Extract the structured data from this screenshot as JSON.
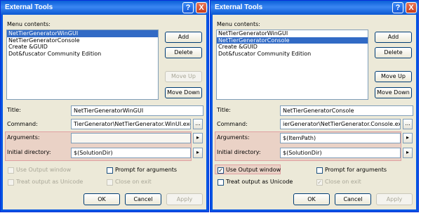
{
  "left": {
    "title": "External Tools",
    "help_glyph": "?",
    "close_glyph": "X",
    "menu_contents_label": "Menu contents:",
    "menu_items": [
      "NetTierGeneratorWinGUI",
      "NetTierGeneratorConsole",
      "Create &GUID",
      "Dot&fuscator Community Edition"
    ],
    "selected_index": 0,
    "add": "Add",
    "delete": "Delete",
    "move_up": "Move Up",
    "move_down": "Move Down",
    "title_label": "Title:",
    "title_value": "NetTierGeneratorWinGUI",
    "command_label": "Command:",
    "command_value": "TierGenerator\\NetTierGenerator.WinUI.exe",
    "browse": "...",
    "arguments_label": "Arguments:",
    "arguments_value": "",
    "initdir_label": "Initial directory:",
    "initdir_value": "$(SolutionDir)",
    "arrow": "▸",
    "use_output": "Use Output window",
    "use_output_checked": false,
    "prompt_args": "Prompt for arguments",
    "prompt_checked": false,
    "unicode": "Treat output as Unicode",
    "close_exit": "Close on exit",
    "ok": "OK",
    "cancel": "Cancel",
    "apply": "Apply"
  },
  "right": {
    "title": "External Tools",
    "help_glyph": "?",
    "close_glyph": "X",
    "menu_contents_label": "Menu contents:",
    "menu_items": [
      "NetTierGeneratorWinGUI",
      "NetTierGeneratorConsole",
      "Create &GUID",
      "Dot&fuscator Community Edition"
    ],
    "selected_index": 1,
    "add": "Add",
    "delete": "Delete",
    "move_up": "Move Up",
    "move_down": "Move Down",
    "title_label": "Title:",
    "title_value": "NetTierGeneratorConsole",
    "command_label": "Command:",
    "command_value": "ierGenerator\\NetTierGenerator.Console.exe",
    "browse": "...",
    "arguments_label": "Arguments:",
    "arguments_value": "$(ItemPath)",
    "initdir_label": "Initial directory:",
    "initdir_value": "$(SolutionDir)",
    "arrow": "▸",
    "use_output": "Use Output window",
    "use_output_checked": true,
    "prompt_args": "Prompt for arguments",
    "prompt_checked": false,
    "unicode": "Treat output as Unicode",
    "close_exit": "Close on exit",
    "close_exit_checked": true,
    "check_mark": "✓",
    "ok": "OK",
    "cancel": "Cancel",
    "apply": "Apply"
  }
}
